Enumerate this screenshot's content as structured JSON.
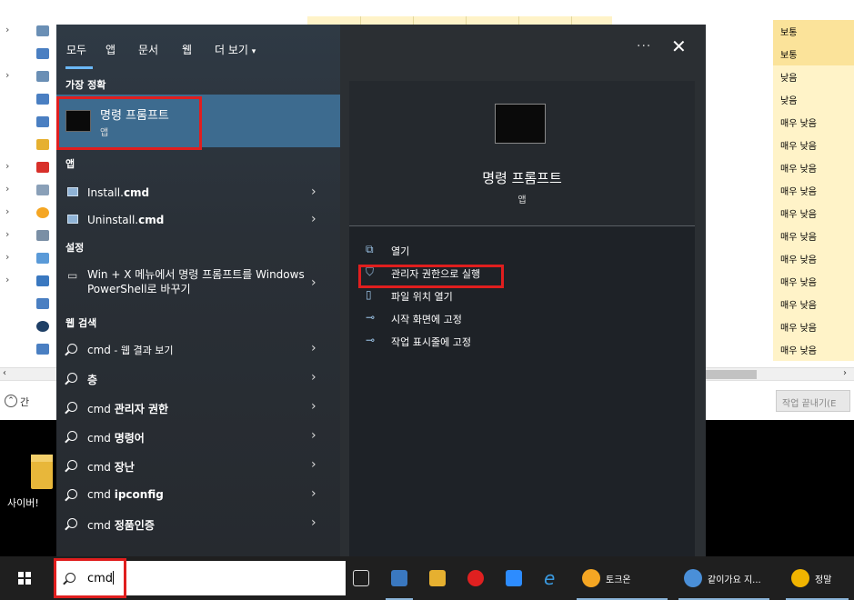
{
  "task_manager": {
    "importance_values": [
      "보통",
      "보통",
      "낮음",
      "낮음",
      "매우 낮음",
      "매우 낮음",
      "매우 낮음",
      "매우 낮음",
      "매우 낮음",
      "매우 낮음",
      "매우 낮음",
      "매우 낮음",
      "매우 낮음",
      "매우 낮음",
      "매우 낮음"
    ],
    "footer_collapse_label": "간",
    "end_task_label": "작업 끝내기(E"
  },
  "desktop": {
    "icon_label": "사이버!"
  },
  "start_menu": {
    "tabs": [
      "모두",
      "앱",
      "문서",
      "웹",
      "더 보기"
    ],
    "more_caret": "▾",
    "ellipsis": "···",
    "close": "✕",
    "best_match_heading": "가장 정확",
    "best_match": {
      "name": "명령 프롬프트",
      "type": "앱"
    },
    "apps_heading": "앱",
    "apps": [
      {
        "prefix": "Install.",
        "bold": "cmd"
      },
      {
        "prefix": "Uninstall.",
        "bold": "cmd"
      }
    ],
    "settings_heading": "설정",
    "setting_item": "Win + X 메뉴에서 명령 프롬프트를 Windows PowerShell로 바꾸기",
    "web_heading": "웹 검색",
    "web_results": [
      {
        "prefix": "cmd",
        "bold": "",
        "suffix": " - 웹 결과 보기"
      },
      {
        "prefix": "",
        "bold": "층",
        "suffix": ""
      },
      {
        "prefix": "cmd ",
        "bold": "관리자 권한",
        "suffix": ""
      },
      {
        "prefix": "cmd ",
        "bold": "명령어",
        "suffix": ""
      },
      {
        "prefix": "cmd ",
        "bold": "장난",
        "suffix": ""
      },
      {
        "prefix": "cmd ",
        "bold": "ipconfig",
        "suffix": ""
      },
      {
        "prefix": "cmd ",
        "bold": "정품인증",
        "suffix": ""
      }
    ],
    "preview": {
      "name": "명령 프롬프트",
      "type": "앱"
    },
    "actions": [
      "열기",
      "관리자 권한으로 실행",
      "파일 위치 열기",
      "시작 화면에 고정",
      "작업 표시줄에 고정"
    ]
  },
  "taskbar": {
    "search_query": "cmd",
    "apps": [
      {
        "label": "토크온",
        "color": "#f5a623"
      },
      {
        "label": "같이가요 지...",
        "color": "#4a8fd8"
      },
      {
        "label": "정말",
        "color": "#f0b400"
      }
    ]
  },
  "colors": {
    "accent": "#3d6b8f",
    "highlight_box": "#e01e1e",
    "importance_bg": "#fff3c8"
  }
}
